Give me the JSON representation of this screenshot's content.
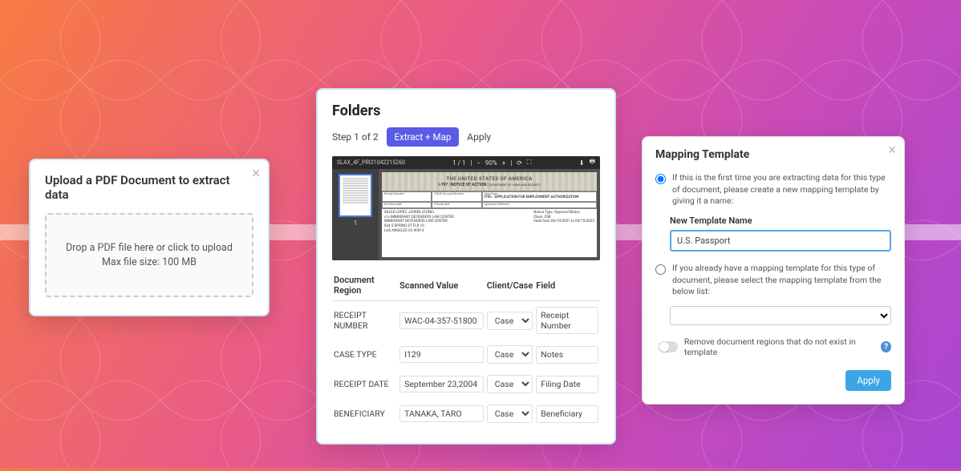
{
  "upload": {
    "title": "Upload a PDF Document to extract data",
    "drop_line1": "Drop a PDF file here or click to upload",
    "drop_line2": "Max file size: 100 MB"
  },
  "folders": {
    "title": "Folders",
    "step_label": "Step 1 of 2",
    "extract_btn": "Extract + Map",
    "apply_btn": "Apply",
    "pdf_filename": "SLAX_4F_PRI21042215260",
    "pdf_page_indicator": "1 / 1",
    "pdf_zoom": "—",
    "pdf_thumb_num": "1",
    "doc_header1": "THE UNITED STATES OF AMERICA",
    "doc_header2": "I-797 | NOTICE OF ACTION |",
    "doc_header3": "DEPARTMENT OF HOMELAND SECURITY",
    "doc_cells": {
      "receipt_number_label": "Receipt Number",
      "receipt_number_val": "",
      "case_type_label": "USCIS Account Number",
      "case_type_val": "",
      "case_type2_label": "Case Type",
      "case_type2_val": "I765 - APPLICATION FOR EMPLOYMENT AUTHORIZATION",
      "received_label": "Received Date",
      "priority_label": "Priority Date",
      "applicant_label": "Applicant/Petitioner"
    },
    "doc_bottom_left": "SALES LOPEZ, JAIRON LEONEL\nc/o IMMIGRANT DEFENDERS LAW CENTER\nIMMIGRANT DEFENDERS LAW CENTER\n634 S SPRING ST FLR 10\nLOS ANGELES CA 90014",
    "doc_bottom_right": "Notice Type: Approval Notice\nClass: C08\nValid from 04/10/2021 to 04/15/2023",
    "columns": [
      "Document Region",
      "Scanned Value",
      "Client/Case",
      "Field"
    ],
    "rows": [
      {
        "region": "RECEIPT NUMBER",
        "value": "WAC-04-357-51800",
        "cc": "Case",
        "field": "Receipt Number"
      },
      {
        "region": "CASE TYPE",
        "value": "I129",
        "cc": "Case",
        "field": "Notes"
      },
      {
        "region": "RECEIPT DATE",
        "value": "September 23,2004",
        "cc": "Case",
        "field": "Filing Date"
      },
      {
        "region": "BENEFICIARY",
        "value": "TANAKA, TARO",
        "cc": "Case",
        "field": "Beneficiary"
      }
    ]
  },
  "mapping": {
    "title": "Mapping Template",
    "radio1_text": "If this is the first time you are extracting data for this type of document, please create a new mapping template by giving it a name:",
    "new_template_label": "New Template Name",
    "new_template_value": "U.S. Passport",
    "radio2_text": "If you already have a mapping template for this type of document, please select the mapping template from the below list:",
    "toggle_label": "Remove document regions that do not exist in template",
    "apply_btn": "Apply"
  }
}
